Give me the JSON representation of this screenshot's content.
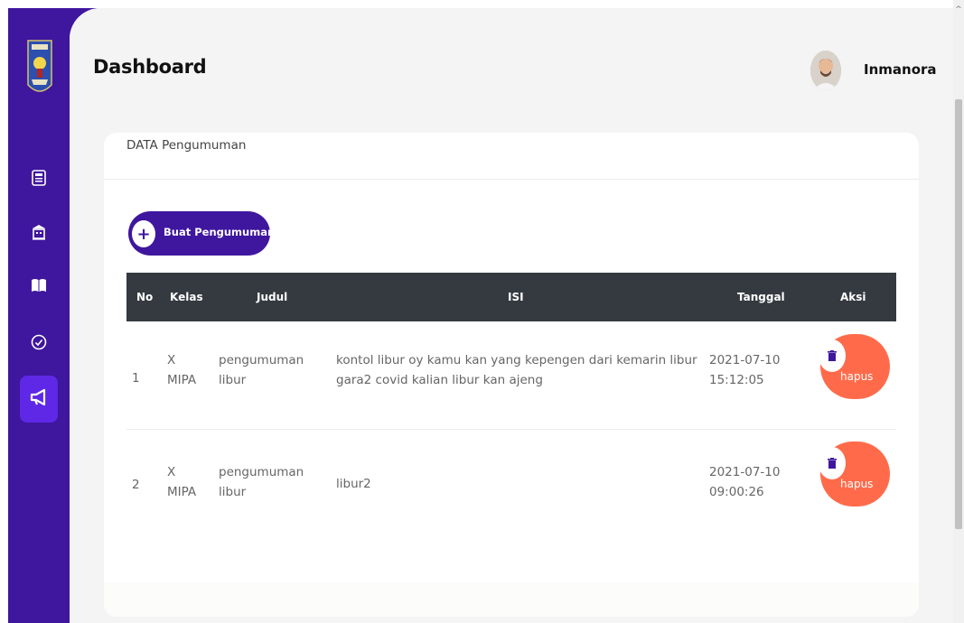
{
  "header": {
    "title": "Dashboard",
    "username": "Inmanora"
  },
  "sidebar": {
    "items": [
      {
        "icon": "id-card-icon",
        "active": false
      },
      {
        "icon": "building-icon",
        "active": false
      },
      {
        "icon": "book-icon",
        "active": false
      },
      {
        "icon": "check-circle-icon",
        "active": false
      },
      {
        "icon": "megaphone-icon",
        "active": true
      }
    ]
  },
  "card": {
    "title": "DATA Pengumuman",
    "create_button": "Buat Pengumuman"
  },
  "table": {
    "columns": [
      "No",
      "Kelas",
      "Judul",
      "ISI",
      "Tanggal",
      "Aksi"
    ],
    "rows": [
      {
        "no": "1",
        "kelas_1": "X",
        "kelas_2": "MIPA",
        "judul_1": "pengumuman",
        "judul_2": "libur",
        "isi_1": "kontol libur oy kamu kan yang kepengen dari kemarin libur",
        "isi_2": "gara2 covid kalian libur kan ajeng",
        "tanggal_1": "2021-07-10",
        "tanggal_2": "15:12:05",
        "action": "hapus"
      },
      {
        "no": "2",
        "kelas_1": "X",
        "kelas_2": "MIPA",
        "judul_1": "pengumuman",
        "judul_2": "libur",
        "isi_1": "libur2",
        "isi_2": "",
        "tanggal_1": "2021-07-10",
        "tanggal_2": "09:00:26",
        "action": "hapus"
      }
    ]
  },
  "colors": {
    "sidebar": "#3f169e",
    "sidebar_active": "#5e28e6",
    "table_header": "#343a40",
    "delete_button": "#ff6b4a"
  }
}
